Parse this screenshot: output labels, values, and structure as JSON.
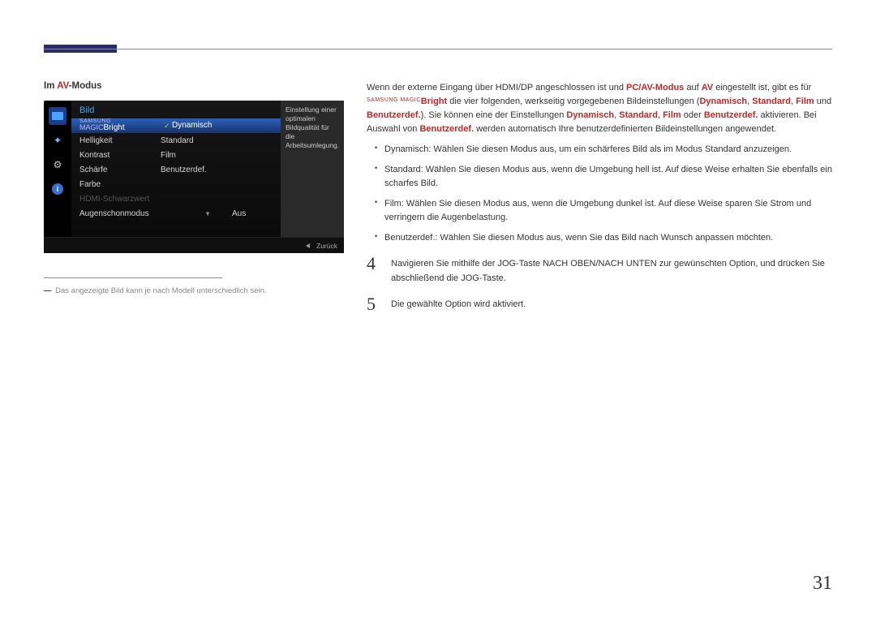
{
  "page_number": "31",
  "heading": {
    "prefix": "Im ",
    "accent": "AV",
    "suffix": "-Modus"
  },
  "osd": {
    "title": "Bild",
    "brand_top": "SAMSUNG",
    "brand_bottom": "MAGIC",
    "brand_word": "Bright",
    "rows": {
      "magicbright": {
        "label": "Bright",
        "dyn": "Dynamisch",
        "std": "Standard",
        "film": "Film",
        "user": "Benutzerdef."
      },
      "helligkeit": "Helligkeit",
      "kontrast": "Kontrast",
      "schaerfe": "Schärfe",
      "farbe": "Farbe",
      "hdmi": "HDMI-Schwarzwert",
      "eye": "Augenschonmodus",
      "eye_val": "Aus"
    },
    "info": "Einstellung einer optimalen Bildqualität für die Arbeitsumlegung.",
    "footer": "Zurück"
  },
  "footnote": "Das angezeigte Bild kann je nach Modell unterschiedlich sein.",
  "intro": {
    "t1": "Wenn der externe Eingang über HDMI/DP angeschlossen ist und ",
    "pcav": "PC/AV-Modus",
    "t2": " auf ",
    "av": "AV",
    "t3": " eingestellt ist, gibt es für ",
    "smagic": "SAMSUNG MAGIC",
    "bright": "Bright",
    "t4": " die vier folgenden, werkseitig vorgegebenen Bildeinstellungen (",
    "dyn": "Dynamisch",
    "c1": ", ",
    "std": "Standard",
    "c2": ", ",
    "film": "Film",
    "and": " und ",
    "user": "Benutzerdef.",
    "t5": "). Sie können eine der Einstellungen ",
    "t6": " oder ",
    "t7": " aktivieren. Bei Auswahl von ",
    "t8": " werden automatisch Ihre benutzerdefinierten Bildeinstellungen angewendet."
  },
  "bullets": {
    "dyn": {
      "h": "Dynamisch",
      "t1": ": Wählen Sie diesen Modus aus, um ein schärferes Bild als im Modus ",
      "std": "Standard",
      "t2": " anzuzeigen."
    },
    "std": {
      "h": "Standard",
      "t": ": Wählen Sie diesen Modus aus, wenn die Umgebung hell ist. Auf diese Weise erhalten Sie ebenfalls ein scharfes Bild."
    },
    "film": {
      "h": "Film",
      "t": ": Wählen Sie diesen Modus aus, wenn die Umgebung dunkel ist. Auf diese Weise sparen Sie Strom und verringern die Augenbelastung."
    },
    "user": {
      "h": "Benutzerdef.",
      "t": ": Wählen Sie diesen Modus aus, wenn Sie das Bild nach Wunsch anpassen möchten."
    }
  },
  "steps": {
    "s4n": "4",
    "s4": "Navigieren Sie mithilfe der JOG-Taste NACH OBEN/NACH UNTEN zur gewünschten Option, und drücken Sie abschließend die JOG-Taste.",
    "s5n": "5",
    "s5": "Die gewählte Option wird aktiviert."
  }
}
